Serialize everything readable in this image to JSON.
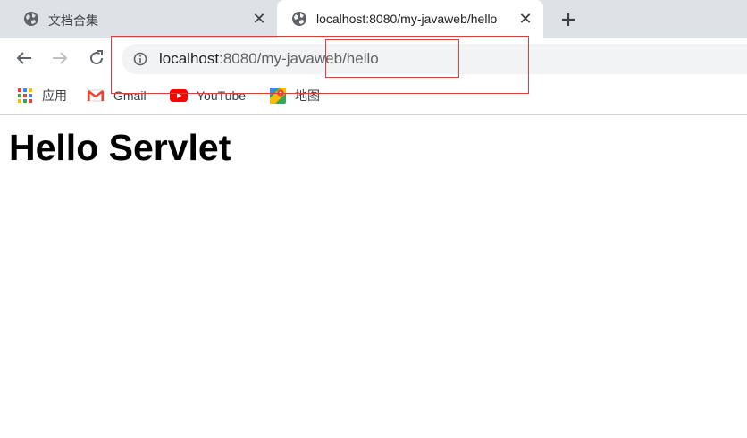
{
  "tabs": [
    {
      "title": "文档合集",
      "active": false
    },
    {
      "title": "localhost:8080/my-javaweb/hello",
      "active": true
    }
  ],
  "address_bar": {
    "host": "localhost",
    "path": ":8080/my-javaweb/hello"
  },
  "bookmarks": [
    {
      "label": "应用",
      "icon": "apps-grid-icon"
    },
    {
      "label": "Gmail",
      "icon": "gmail-icon"
    },
    {
      "label": "YouTube",
      "icon": "youtube-icon"
    },
    {
      "label": "地图",
      "icon": "maps-icon"
    }
  ],
  "page": {
    "heading": "Hello Servlet"
  },
  "colors": {
    "tab_strip": "#dee1e6",
    "omnibox": "#f1f3f4",
    "annotation": "#d9413c"
  }
}
